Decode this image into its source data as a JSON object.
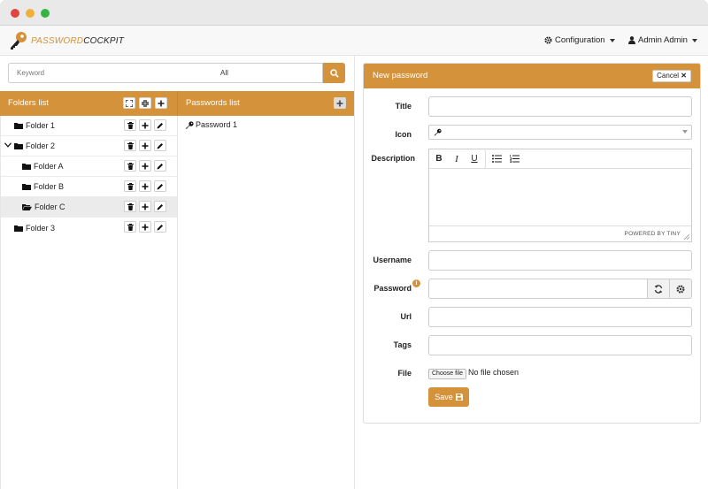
{
  "app": {
    "brand_part1": "PASSWORD",
    "brand_part2": "COCKPIT",
    "accent_color": "#d4923a"
  },
  "navbar": {
    "configuration_label": "Configuration",
    "user_label": "Admin Admin"
  },
  "search": {
    "placeholder": "Keyword",
    "scope_value": "All"
  },
  "folders_panel": {
    "title": "Folders list",
    "items": [
      {
        "label": "Folder 1"
      },
      {
        "label": "Folder 2"
      },
      {
        "label": "Folder A"
      },
      {
        "label": "Folder B"
      },
      {
        "label": "Folder C"
      },
      {
        "label": "Folder 3"
      }
    ]
  },
  "passwords_panel": {
    "title": "Passwords list",
    "items": [
      {
        "label": "Password 1"
      }
    ]
  },
  "form": {
    "title": "New password",
    "cancel_label": "Cancel",
    "labels": {
      "title": "Title",
      "icon": "Icon",
      "description": "Description",
      "username": "Username",
      "password": "Password",
      "url": "Url",
      "tags": "Tags",
      "file": "File"
    },
    "editor_status": "POWERED BY TINY",
    "file_button": "Choose file",
    "file_status": "No file chosen",
    "save_label": "Save"
  }
}
